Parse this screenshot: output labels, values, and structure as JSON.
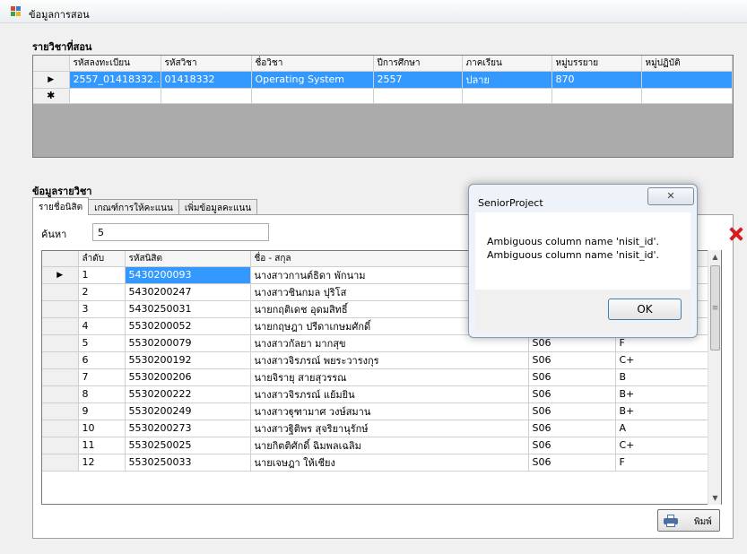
{
  "window": {
    "title": "ข้อมูลการสอน"
  },
  "course_section": {
    "title": "รายวิชาที่สอน",
    "columns": [
      "รหัสลงทะเบียน",
      "รหัสวิชา",
      "ชื่อวิชา",
      "ปีการศึกษา",
      "ภาคเรียน",
      "หมู่บรรยาย",
      "หมู่ปฏิบัติ"
    ],
    "rows": [
      {
        "indicator": "▶",
        "cells": [
          "2557_01418332...",
          "01418332",
          "Operating System",
          "2557",
          "ปลาย",
          "870",
          ""
        ]
      },
      {
        "indicator": "✱",
        "cells": [
          "",
          "",
          "",
          "",
          "",
          "",
          ""
        ]
      }
    ]
  },
  "detail_section": {
    "title": "ข้อมูลรายวิชา",
    "tabs": [
      "รายชื่อนิสิต",
      "เกณฑ์การให้คะแนน",
      "เพิ่มข้อมูลคะแนน"
    ],
    "search_label": "ค้นหา",
    "search_value": "5",
    "columns": [
      "ลำดับ",
      "รหัสนิสิต",
      "ชื่อ - สกุล",
      "",
      ""
    ],
    "rows": [
      {
        "indicator": "▶",
        "cells": [
          "1",
          "5430200093",
          "นางสาวกานต์ธิดา พักนาม",
          "",
          ""
        ]
      },
      {
        "indicator": "",
        "cells": [
          "2",
          "5430200247",
          "นางสาวชินกมล ปุริโส",
          "",
          ""
        ]
      },
      {
        "indicator": "",
        "cells": [
          "3",
          "5430250031",
          "นายกฤติเดช อุดมสิทธิ์",
          "",
          ""
        ]
      },
      {
        "indicator": "",
        "cells": [
          "4",
          "5530200052",
          "นายกฤษฎา ปรีดาเกษมศักดิ์",
          "S06",
          "C+"
        ]
      },
      {
        "indicator": "",
        "cells": [
          "5",
          "5530200079",
          "นางสาวกัลยา มากสุข",
          "S06",
          "F"
        ]
      },
      {
        "indicator": "",
        "cells": [
          "6",
          "5530200192",
          "นางสาวจิรภรณ์ พยระวารงกุร",
          "S06",
          "C+"
        ]
      },
      {
        "indicator": "",
        "cells": [
          "7",
          "5530200206",
          "นายจิรายุ สายสุวรรณ",
          "S06",
          "B"
        ]
      },
      {
        "indicator": "",
        "cells": [
          "8",
          "5530200222",
          "นางสาวจิรภรณ์ แย้มยิน",
          "S06",
          "B+"
        ]
      },
      {
        "indicator": "",
        "cells": [
          "9",
          "5530200249",
          "นางสาวฐุฑามาศ วงษ์สมาน",
          "S06",
          "B+"
        ]
      },
      {
        "indicator": "",
        "cells": [
          "10",
          "5530200273",
          "นางสาวฐิติพร สุจริยานุรักษ์",
          "S06",
          "A"
        ]
      },
      {
        "indicator": "",
        "cells": [
          "11",
          "5530250025",
          "นายกิตติศักดิ์ ฉิมพลเฉลิม",
          "S06",
          "C+"
        ]
      },
      {
        "indicator": "",
        "cells": [
          "12",
          "5530250033",
          "นายเจษฎา ให้เชียง",
          "S06",
          "F"
        ]
      }
    ],
    "print_label": "พิมพ์"
  },
  "dialog": {
    "title": "SeniorProject",
    "close_label": "✕",
    "messages": [
      "Ambiguous column name 'nisit_id'.",
      "Ambiguous column name 'nisit_id'."
    ],
    "ok_label": "OK"
  },
  "colors": {
    "selection": "#3399ff",
    "delete_icon": "#d71e1e",
    "dialog_frame": "#eef3fa"
  }
}
